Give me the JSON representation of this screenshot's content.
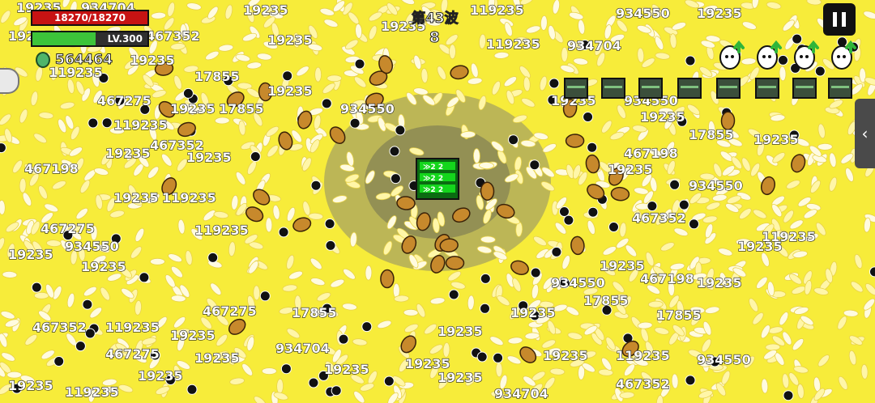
{
  "hud": {
    "hp_text": "18270/18270",
    "hp_fraction": 1.0,
    "level_text": "LV.300",
    "xp_fraction": 0.55,
    "coin_amount": "564464",
    "wave_label": "第43波",
    "wave_count": "8"
  },
  "icons": {
    "pause": "pause-icon",
    "side_tab": "chevron-left-icon",
    "coin": "gem-icon",
    "egg": "egg-upgrade-icon",
    "chest": "chest-icon"
  },
  "upgrade_eggs": [
    {
      "label": "egg-upgrade"
    },
    {
      "label": "egg-upgrade"
    },
    {
      "label": "egg-upgrade"
    },
    {
      "label": "egg-upgrade"
    }
  ],
  "chests_count": 8,
  "colors": {
    "background": "#f7ec3a",
    "rice": "#fffbe0",
    "potato": "#c7892c",
    "bullet": "#111111",
    "player": "#14d61c",
    "hp": "#c71313",
    "xp": "#3cc43a"
  },
  "damage_numbers": [
    "19235",
    "934704",
    "19235",
    "19235",
    "119235",
    "934550",
    "19235",
    "19235",
    "19235",
    "934704",
    "467352",
    "19235",
    "119235",
    "467275",
    "17855",
    "19235",
    "119235",
    "19235",
    "934550",
    "19235",
    "467352",
    "467198",
    "19235",
    "17855",
    "19235",
    "119235",
    "467275",
    "934550",
    "119235",
    "19235",
    "19235",
    "19235",
    "17855",
    "467198",
    "19235",
    "934550",
    "467352",
    "19235",
    "119235",
    "19235",
    "467198",
    "934550",
    "19235",
    "17855",
    "17855",
    "19235",
    "467352",
    "119235",
    "19235",
    "467275"
  ]
}
